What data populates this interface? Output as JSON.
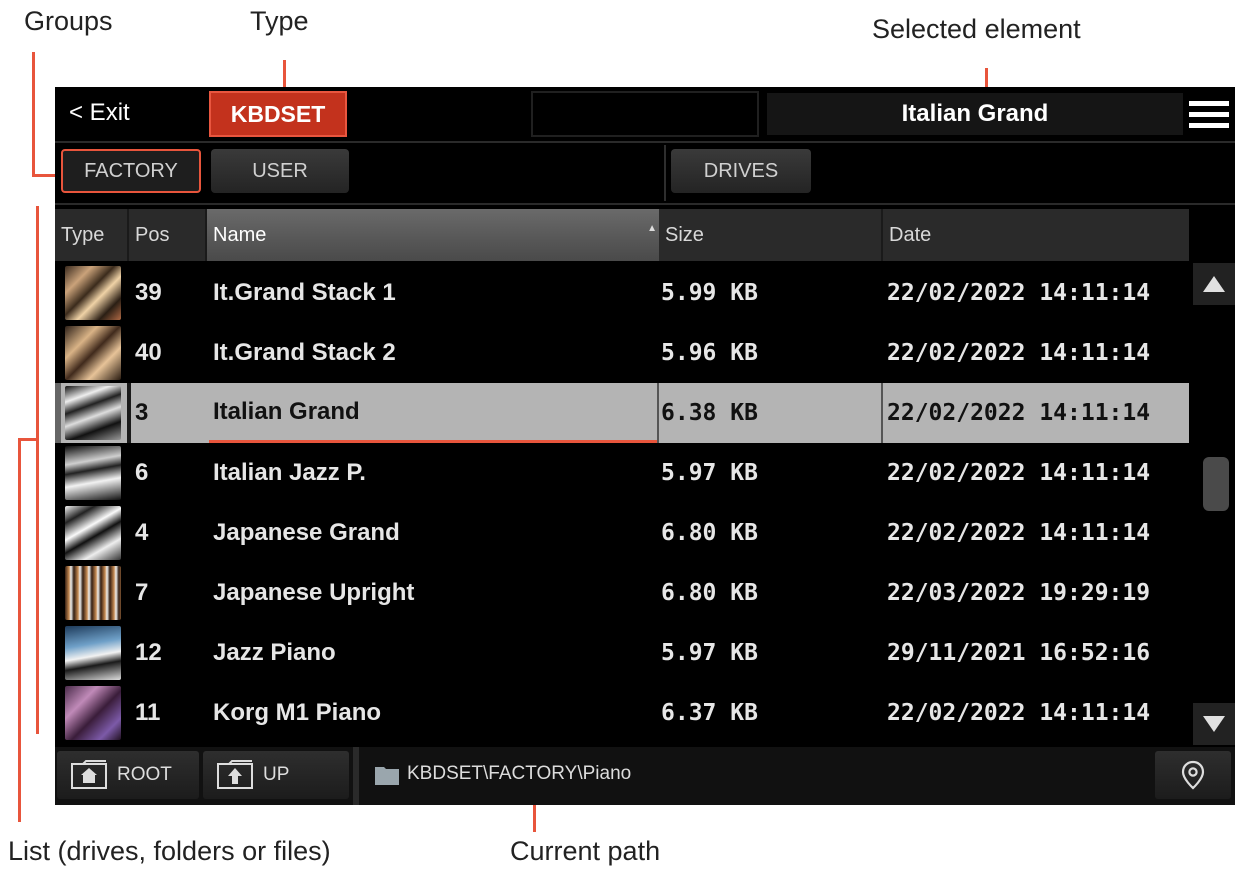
{
  "callouts": {
    "groups": "Groups",
    "type": "Type",
    "selected_element": "Selected element",
    "list": "List (drives, folders or files)",
    "current_path": "Current path"
  },
  "topbar": {
    "exit_label": "< Exit",
    "type_label": "KBDSET",
    "selected_name": "Italian Grand",
    "menu_icon": "hamburger-menu-icon"
  },
  "tabs": {
    "factory": "FACTORY",
    "user": "USER",
    "drives": "DRIVES"
  },
  "list": {
    "headers": {
      "type": "Type",
      "pos": "Pos",
      "name": "Name",
      "size": "Size",
      "date": "Date"
    },
    "rows": [
      {
        "pos": "39",
        "name": "It.Grand Stack 1",
        "size": "5.99 KB",
        "date": "22/02/2022 14:11:14"
      },
      {
        "pos": "40",
        "name": "It.Grand Stack 2",
        "size": "5.96 KB",
        "date": "22/02/2022 14:11:14"
      },
      {
        "pos": "3",
        "name": "Italian Grand",
        "size": "6.38 KB",
        "date": "22/02/2022 14:11:14"
      },
      {
        "pos": "6",
        "name": "Italian Jazz P.",
        "size": "5.97 KB",
        "date": "22/02/2022 14:11:14"
      },
      {
        "pos": "4",
        "name": "Japanese Grand",
        "size": "6.80 KB",
        "date": "22/02/2022 14:11:14"
      },
      {
        "pos": "7",
        "name": "Japanese Upright",
        "size": "6.80 KB",
        "date": "22/03/2022 19:29:19"
      },
      {
        "pos": "12",
        "name": "Jazz Piano",
        "size": "5.97 KB",
        "date": "29/11/2021 16:52:16"
      },
      {
        "pos": "11",
        "name": "Korg M1 Piano",
        "size": "6.37 KB",
        "date": "22/02/2022 14:11:14"
      }
    ],
    "selected_index": 2
  },
  "bottombar": {
    "root_label": "ROOT",
    "up_label": "UP",
    "path": "KBDSET\\FACTORY\\Piano"
  },
  "colors": {
    "accent": "#e8553c",
    "type_button": "#c3321d",
    "selected_row": "#b4b4b4"
  }
}
